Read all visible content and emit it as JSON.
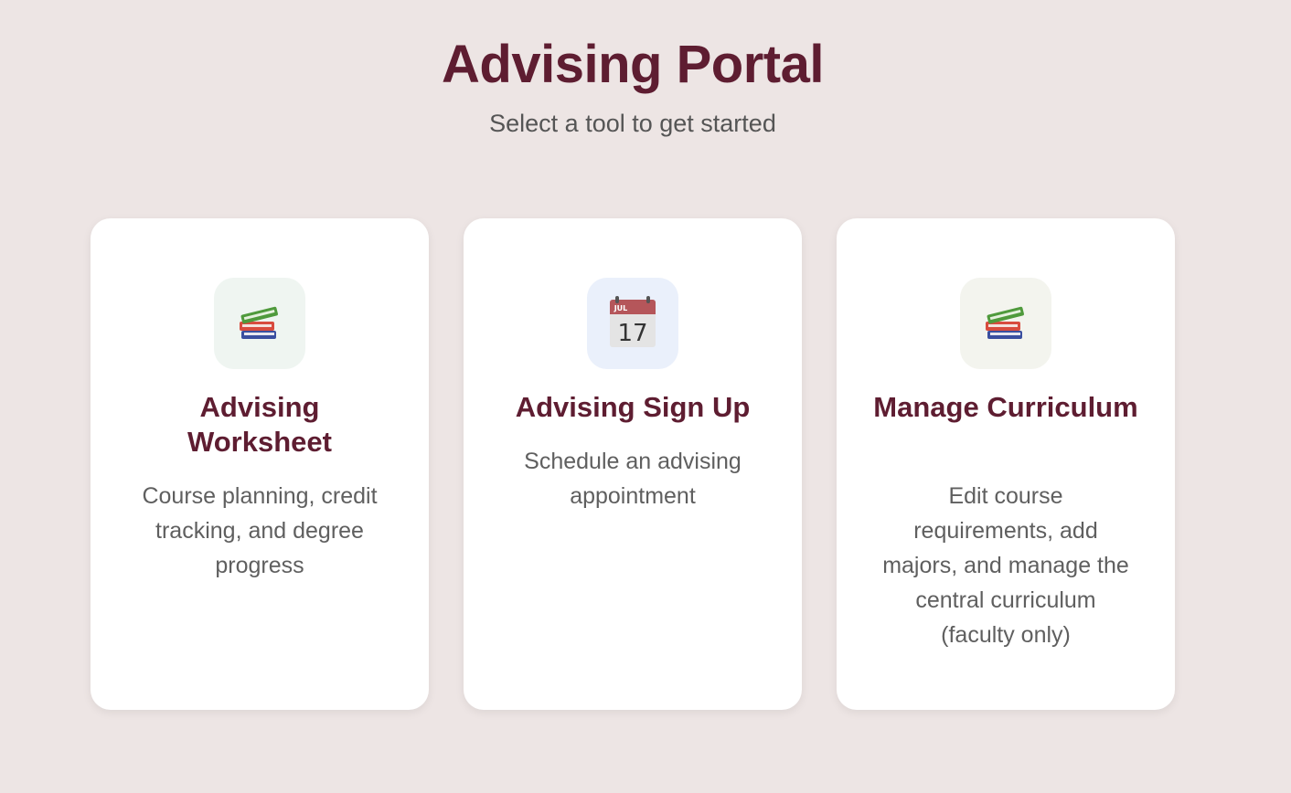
{
  "header": {
    "title": "Advising Portal",
    "subtitle": "Select a tool to get started"
  },
  "cards": [
    {
      "icon": "books-icon",
      "title": "Advising Worksheet",
      "description": "Course planning, credit tracking, and degree progress",
      "icon_bg": "#eff5f1"
    },
    {
      "icon": "calendar-icon",
      "title": "Advising Sign Up",
      "description": "Schedule an advising appointment",
      "icon_bg": "#eaf0fb"
    },
    {
      "icon": "books-icon",
      "title": "Manage Curriculum",
      "description": "Edit course requirements, add majors, and manage the central curriculum (faculty only)",
      "icon_bg": "#f3f4ee"
    }
  ],
  "calendar_icon": {
    "month": "JUL",
    "day": "17"
  },
  "colors": {
    "background": "#ede5e4",
    "accent": "#5e1d31",
    "text_muted": "#5f5f5f"
  }
}
